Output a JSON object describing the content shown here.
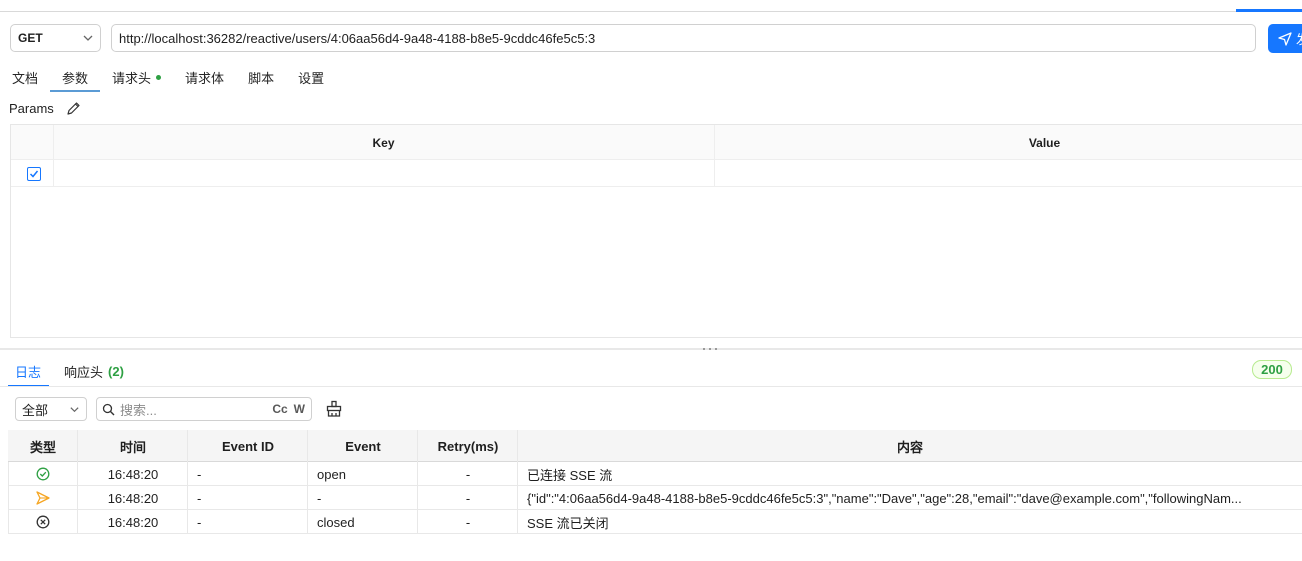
{
  "request": {
    "method": "GET",
    "url": "http://localhost:36282/reactive/users/4:06aa56d4-9a48-4188-b8e5-9cddc46fe5c5:3",
    "send_label": "发"
  },
  "request_tabs": [
    {
      "label": "文档"
    },
    {
      "label": "参数"
    },
    {
      "label": "请求头"
    },
    {
      "label": "请求体"
    },
    {
      "label": "脚本"
    },
    {
      "label": "设置"
    }
  ],
  "params": {
    "label": "Params",
    "key_header": "Key",
    "value_header": "Value",
    "row_checked": true
  },
  "response": {
    "tabs": [
      {
        "label": "日志"
      },
      {
        "label": "响应头",
        "count": "(2)"
      }
    ],
    "status_code": "200",
    "filter": "全部",
    "search_placeholder": "搜索...",
    "case_option": "Cc",
    "word_option": "W"
  },
  "log": {
    "headers": [
      "类型",
      "时间",
      "Event ID",
      "Event",
      "Retry(ms)",
      "内容"
    ],
    "rows": [
      {
        "type_icon": "check-circle-icon",
        "time": "16:48:20",
        "event_id": "-",
        "event": "open",
        "retry": "-",
        "content": "已连接 SSE 流"
      },
      {
        "type_icon": "send-arrow-icon",
        "time": "16:48:20",
        "event_id": "-",
        "event": "-",
        "retry": "-",
        "content": "{\"id\":\"4:06aa56d4-9a48-4188-b8e5-9cddc46fe5c5:3\",\"name\":\"Dave\",\"age\":28,\"email\":\"dave@example.com\",\"followingNam..."
      },
      {
        "type_icon": "close-circle-icon",
        "time": "16:48:20",
        "event_id": "-",
        "event": "closed",
        "retry": "-",
        "content": "SSE 流已关闭"
      }
    ]
  },
  "colors": {
    "accent": "#1677ff",
    "success": "#2ea043",
    "warning": "#f5a623"
  }
}
